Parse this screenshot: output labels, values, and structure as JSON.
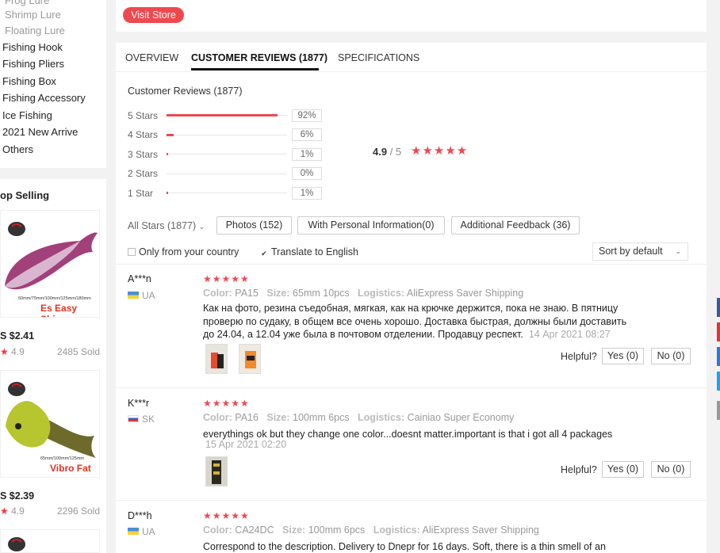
{
  "sidebar": {
    "subcategories": [
      "Frog Lure",
      "Shrimp Lure",
      "Floating Lure"
    ],
    "categories": [
      "Fishing Hook",
      "Fishing Pliers",
      "Fishing Box",
      "Fishing Accessory",
      "Ice Fishing",
      "2021 New Arrive",
      "Others"
    ],
    "top_selling_title": "op Selling",
    "products": [
      {
        "image_caption": "Es Easy Shiner",
        "image_sizes": "50mm/75mm/100mm/125mm/180mm",
        "price": "S $2.41",
        "rating": "4.9",
        "sold": "2485 Sold"
      },
      {
        "image_caption": "Vibro Fat",
        "image_sizes": "65mm/100mm/125mm",
        "price": "S $2.39",
        "rating": "4.9",
        "sold": "2296 Sold"
      }
    ]
  },
  "store": {
    "visit_label": "Visit Store"
  },
  "tabs": [
    {
      "label": "OVERVIEW"
    },
    {
      "label": "CUSTOMER REVIEWS (1877)"
    },
    {
      "label": "SPECIFICATIONS"
    }
  ],
  "reviews_summary": {
    "title": "Customer Reviews (1877)",
    "distribution": [
      {
        "label": "5 Stars",
        "percent": "92%",
        "value": 92
      },
      {
        "label": "4 Stars",
        "percent": "6%",
        "value": 6
      },
      {
        "label": "3 Stars",
        "percent": "1%",
        "value": 1
      },
      {
        "label": "2 Stars",
        "percent": "0%",
        "value": 0
      },
      {
        "label": "1 Star",
        "percent": "1%",
        "value": 1
      }
    ],
    "score": "4.9",
    "score_max": "/ 5",
    "score_stars": "★★★★★"
  },
  "filters": {
    "all_stars": "All Stars (1877)",
    "photos": "Photos (152)",
    "personal_info": "With Personal Information(0)",
    "additional": "Additional Feedback (36)",
    "only_country": "Only from your country",
    "translate": "Translate to English",
    "sort": "Sort by default"
  },
  "reviews": [
    {
      "name": "A***n",
      "country": "UA",
      "stars": "★★★★★",
      "color_label": "Color:",
      "color": "PA15",
      "size_label": "Size:",
      "size": "65mm 10pcs",
      "logistics_label": "Logistics:",
      "logistics": "AliExpress Saver Shipping",
      "text": "Как на фото, резина съедобная, мягкая, как на крючке держится, пока не знаю. В пятницу проверю по судаку, в общем все очень хорошо. Доставка быстрая, должны были доставить до 24.04, а 12.04 уже была в почтовом отделении. Продавцу респект.",
      "date": "14 Apr 2021 08:27",
      "helpful": "Helpful?",
      "yes": "Yes (0)",
      "no": "No (0)"
    },
    {
      "name": "K***r",
      "country": "SK",
      "stars": "★★★★★",
      "color_label": "Color:",
      "color": "PA16",
      "size_label": "Size:",
      "size": "100mm 6pcs",
      "logistics_label": "Logistics:",
      "logistics": "Cainiao Super Economy",
      "text": "everythings ok but they change one color...doesnt matter.important is that i got all 4 packages",
      "date": "15 Apr 2021 02:20",
      "helpful": "Helpful?",
      "yes": "Yes (0)",
      "no": "No (0)"
    },
    {
      "name": "D***h",
      "country": "UA",
      "stars": "★★★★★",
      "color_label": "Color:",
      "color": "CA24DC",
      "size_label": "Size:",
      "size": "100mm 6pcs",
      "logistics_label": "Logistics:",
      "logistics": "AliExpress Saver Shipping",
      "text": "Correspond to the description. Delivery to Dnepr for 16 days. Soft, there is a thin smell of an"
    }
  ],
  "colors": {
    "accent": "#f0484f",
    "muted": "#999999"
  }
}
